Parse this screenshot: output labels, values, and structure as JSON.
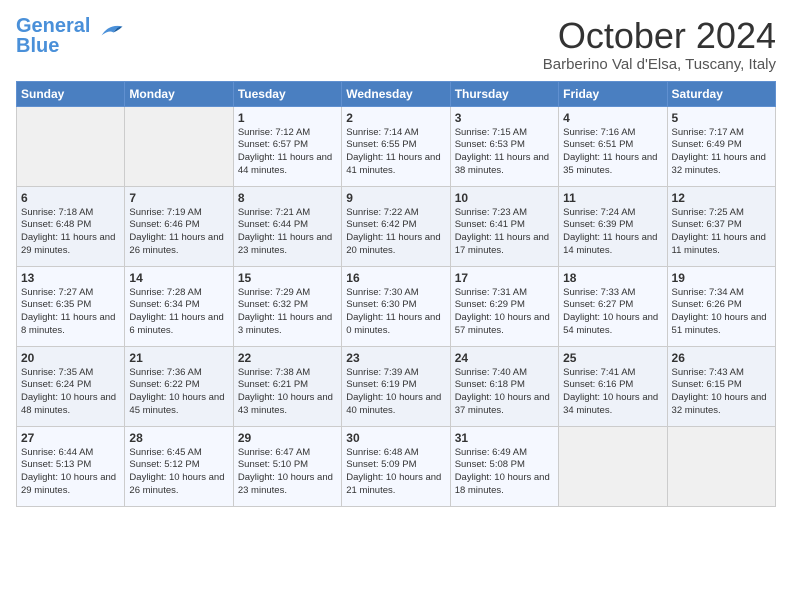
{
  "header": {
    "logo_line1": "General",
    "logo_line2": "Blue",
    "month": "October 2024",
    "location": "Barberino Val d'Elsa, Tuscany, Italy"
  },
  "days_of_week": [
    "Sunday",
    "Monday",
    "Tuesday",
    "Wednesday",
    "Thursday",
    "Friday",
    "Saturday"
  ],
  "weeks": [
    [
      {
        "day": "",
        "info": ""
      },
      {
        "day": "",
        "info": ""
      },
      {
        "day": "1",
        "info": "Sunrise: 7:12 AM\nSunset: 6:57 PM\nDaylight: 11 hours and 44 minutes."
      },
      {
        "day": "2",
        "info": "Sunrise: 7:14 AM\nSunset: 6:55 PM\nDaylight: 11 hours and 41 minutes."
      },
      {
        "day": "3",
        "info": "Sunrise: 7:15 AM\nSunset: 6:53 PM\nDaylight: 11 hours and 38 minutes."
      },
      {
        "day": "4",
        "info": "Sunrise: 7:16 AM\nSunset: 6:51 PM\nDaylight: 11 hours and 35 minutes."
      },
      {
        "day": "5",
        "info": "Sunrise: 7:17 AM\nSunset: 6:49 PM\nDaylight: 11 hours and 32 minutes."
      }
    ],
    [
      {
        "day": "6",
        "info": "Sunrise: 7:18 AM\nSunset: 6:48 PM\nDaylight: 11 hours and 29 minutes."
      },
      {
        "day": "7",
        "info": "Sunrise: 7:19 AM\nSunset: 6:46 PM\nDaylight: 11 hours and 26 minutes."
      },
      {
        "day": "8",
        "info": "Sunrise: 7:21 AM\nSunset: 6:44 PM\nDaylight: 11 hours and 23 minutes."
      },
      {
        "day": "9",
        "info": "Sunrise: 7:22 AM\nSunset: 6:42 PM\nDaylight: 11 hours and 20 minutes."
      },
      {
        "day": "10",
        "info": "Sunrise: 7:23 AM\nSunset: 6:41 PM\nDaylight: 11 hours and 17 minutes."
      },
      {
        "day": "11",
        "info": "Sunrise: 7:24 AM\nSunset: 6:39 PM\nDaylight: 11 hours and 14 minutes."
      },
      {
        "day": "12",
        "info": "Sunrise: 7:25 AM\nSunset: 6:37 PM\nDaylight: 11 hours and 11 minutes."
      }
    ],
    [
      {
        "day": "13",
        "info": "Sunrise: 7:27 AM\nSunset: 6:35 PM\nDaylight: 11 hours and 8 minutes."
      },
      {
        "day": "14",
        "info": "Sunrise: 7:28 AM\nSunset: 6:34 PM\nDaylight: 11 hours and 6 minutes."
      },
      {
        "day": "15",
        "info": "Sunrise: 7:29 AM\nSunset: 6:32 PM\nDaylight: 11 hours and 3 minutes."
      },
      {
        "day": "16",
        "info": "Sunrise: 7:30 AM\nSunset: 6:30 PM\nDaylight: 11 hours and 0 minutes."
      },
      {
        "day": "17",
        "info": "Sunrise: 7:31 AM\nSunset: 6:29 PM\nDaylight: 10 hours and 57 minutes."
      },
      {
        "day": "18",
        "info": "Sunrise: 7:33 AM\nSunset: 6:27 PM\nDaylight: 10 hours and 54 minutes."
      },
      {
        "day": "19",
        "info": "Sunrise: 7:34 AM\nSunset: 6:26 PM\nDaylight: 10 hours and 51 minutes."
      }
    ],
    [
      {
        "day": "20",
        "info": "Sunrise: 7:35 AM\nSunset: 6:24 PM\nDaylight: 10 hours and 48 minutes."
      },
      {
        "day": "21",
        "info": "Sunrise: 7:36 AM\nSunset: 6:22 PM\nDaylight: 10 hours and 45 minutes."
      },
      {
        "day": "22",
        "info": "Sunrise: 7:38 AM\nSunset: 6:21 PM\nDaylight: 10 hours and 43 minutes."
      },
      {
        "day": "23",
        "info": "Sunrise: 7:39 AM\nSunset: 6:19 PM\nDaylight: 10 hours and 40 minutes."
      },
      {
        "day": "24",
        "info": "Sunrise: 7:40 AM\nSunset: 6:18 PM\nDaylight: 10 hours and 37 minutes."
      },
      {
        "day": "25",
        "info": "Sunrise: 7:41 AM\nSunset: 6:16 PM\nDaylight: 10 hours and 34 minutes."
      },
      {
        "day": "26",
        "info": "Sunrise: 7:43 AM\nSunset: 6:15 PM\nDaylight: 10 hours and 32 minutes."
      }
    ],
    [
      {
        "day": "27",
        "info": "Sunrise: 6:44 AM\nSunset: 5:13 PM\nDaylight: 10 hours and 29 minutes."
      },
      {
        "day": "28",
        "info": "Sunrise: 6:45 AM\nSunset: 5:12 PM\nDaylight: 10 hours and 26 minutes."
      },
      {
        "day": "29",
        "info": "Sunrise: 6:47 AM\nSunset: 5:10 PM\nDaylight: 10 hours and 23 minutes."
      },
      {
        "day": "30",
        "info": "Sunrise: 6:48 AM\nSunset: 5:09 PM\nDaylight: 10 hours and 21 minutes."
      },
      {
        "day": "31",
        "info": "Sunrise: 6:49 AM\nSunset: 5:08 PM\nDaylight: 10 hours and 18 minutes."
      },
      {
        "day": "",
        "info": ""
      },
      {
        "day": "",
        "info": ""
      }
    ]
  ]
}
